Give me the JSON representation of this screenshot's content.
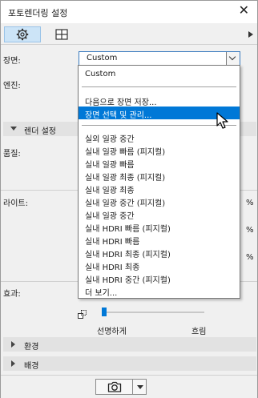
{
  "window": {
    "title": "포토렌더링 설정",
    "close_glyph": "✕"
  },
  "tabs": [
    {
      "icon": "gear-icon",
      "selected": true
    },
    {
      "icon": "layout-grid-icon",
      "selected": false
    }
  ],
  "fields": {
    "scene_label": "장면:",
    "engine_label": "엔진:",
    "quality_label": "품질:",
    "light_label": "라이트:",
    "effects_label": "효과:"
  },
  "scene_combo": {
    "value": "Custom"
  },
  "render_section": {
    "label": "렌더 설정"
  },
  "light_percents": [
    "%",
    "%",
    "%"
  ],
  "dropdown": {
    "items": [
      {
        "label": "Custom"
      },
      {
        "label": "다음으로 장면 저장..."
      },
      {
        "label": "장면 선택 및 관리...",
        "highlighted": true
      },
      {
        "label": "실외 일광 중간"
      },
      {
        "label": "실내 일광 빠름 (피지컬)"
      },
      {
        "label": "실내 일광 빠름"
      },
      {
        "label": "실내 일광 최종 (피지컬)"
      },
      {
        "label": "실내 일광 최종"
      },
      {
        "label": "실내 일광 중간 (피지컬)"
      },
      {
        "label": "실내 일광 중간"
      },
      {
        "label": "실내 HDRI 빠름 (피지컬)"
      },
      {
        "label": "실내 HDRI 빠름"
      },
      {
        "label": "실내 HDRI 최종 (피지컬)"
      },
      {
        "label": "실내 HDRI 최종"
      },
      {
        "label": "실내 HDRI 중간 (피지컬)"
      },
      {
        "label": "더 보기..."
      }
    ]
  },
  "effects_slider": {
    "left_label": "선명하게",
    "right_label": "흐림",
    "value": 0.0
  },
  "sections": {
    "environment": "환경",
    "background": "배경"
  },
  "colors": {
    "accent": "#0078d7",
    "panel": "#f0f0f0",
    "section": "#e2e2e2"
  }
}
